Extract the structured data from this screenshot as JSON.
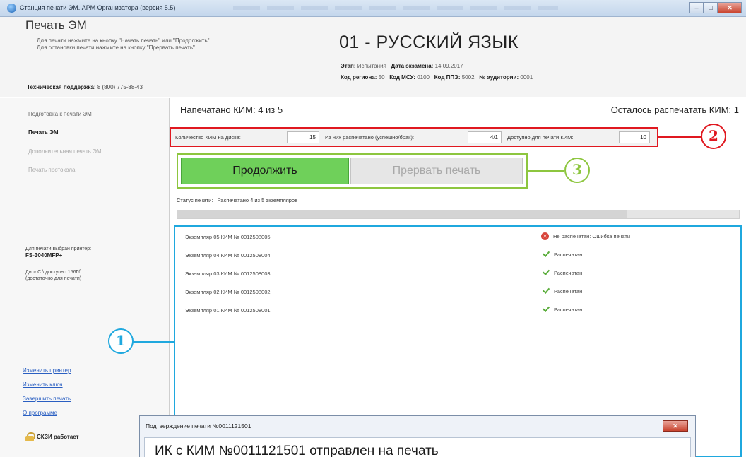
{
  "window": {
    "title": "Станция печати ЭМ. АРМ Организатора (версия 5.5)",
    "minimize_label": "–",
    "maximize_label": "□",
    "close_label": "✕"
  },
  "header": {
    "title": "Печать ЭМ",
    "instruction_line1": "Для печати нажмите на кнопку \"Начать печать\" или \"Продолжить\".",
    "instruction_line2": "Для остановки печати нажмите на кнопку \"Прервать печать\".",
    "support_label": "Техническая поддержка:",
    "support_phone": "8 (800) 775-88-43",
    "subject": "01 - РУССКИЙ ЯЗЫК",
    "stage_label": "Этап:",
    "stage_value": "Испытания",
    "exam_date_label": "Дата экзамена:",
    "exam_date_value": "14.09.2017",
    "region_label": "Код региона:",
    "region_value": "50",
    "msu_label": "Код МСУ:",
    "msu_value": "0100",
    "ppe_label": "Код ППЭ:",
    "ppe_value": "5002",
    "room_label": "№ аудитории:",
    "room_value": "0001"
  },
  "sidebar": {
    "items": [
      {
        "label": "Подготовка к печати ЭМ",
        "state": "normal"
      },
      {
        "label": "Печать ЭМ",
        "state": "active"
      },
      {
        "label": "Дополнительная печать ЭМ",
        "state": "disabled"
      },
      {
        "label": "Печать протокола",
        "state": "disabled"
      }
    ],
    "printer_caption": "Для печати выбран принтер:",
    "printer_name": "FS-3040MFP+",
    "disk_line1": "Диск C:\\ доступно 156Гб",
    "disk_line2": "(достаточно для печати)",
    "links": [
      "Изменить принтер",
      "Изменить ключ",
      "Завершить печать",
      "О программе"
    ],
    "cscm_status": "СКЗИ работает"
  },
  "main": {
    "printed_text": "Напечатано КИМ:  4  из  5",
    "remaining_text": "Осталось распечатать КИМ:  1",
    "stats": {
      "kim_on_disk_label": "Количество КИМ на диске:",
      "kim_on_disk_value": "15",
      "printed_label": "Из них распечатано (успешно/брак):",
      "printed_value": "4/1",
      "available_label": "Доступно для печати КИМ:",
      "available_value": "10"
    },
    "continue_label": "Продолжить",
    "abort_label": "Прервать печать",
    "status_label": "Статус печати:",
    "status_value": "Распечатано 4 из 5 экземпляров",
    "progress_fraction": 0.8,
    "rows": [
      {
        "text": "Экземпляр 05  КИМ № 0012508005",
        "status": "Не распечатан: Ошибка печати",
        "ok": false
      },
      {
        "text": "Экземпляр 04  КИМ № 0012508004",
        "status": "Распечатан",
        "ok": true
      },
      {
        "text": "Экземпляр 03  КИМ № 0012508003",
        "status": "Распечатан",
        "ok": true
      },
      {
        "text": "Экземпляр 02  КИМ № 0012508002",
        "status": "Распечатан",
        "ok": true
      },
      {
        "text": "Экземпляр 01  КИМ № 0012508001",
        "status": "Распечатан",
        "ok": true
      }
    ]
  },
  "callouts": {
    "one": "1",
    "two": "2",
    "three": "3",
    "colors": {
      "one": "#1fa8de",
      "two": "#e01820",
      "three": "#8dc63f"
    }
  },
  "dialog": {
    "title": "Подтверждение печати  №0011121501",
    "close_label": "✕",
    "message": "ИК с КИМ №0011121501 отправлен на печать"
  }
}
